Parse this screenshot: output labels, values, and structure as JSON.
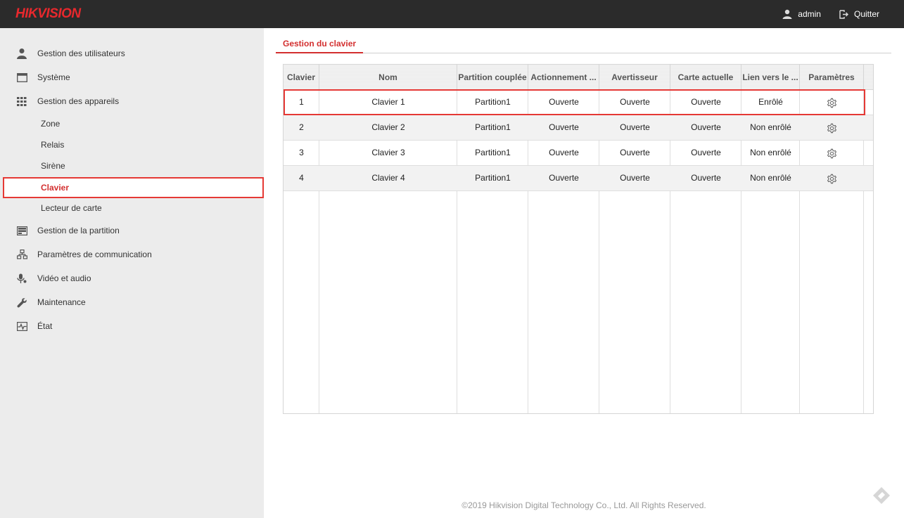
{
  "header": {
    "brand": "HIKVISION",
    "user": "admin",
    "logout": "Quitter"
  },
  "sidebar": {
    "items": [
      {
        "label": "Gestion des utilisateurs",
        "icon": "user-icon"
      },
      {
        "label": "Système",
        "icon": "window-icon"
      },
      {
        "label": "Gestion des appareils",
        "icon": "grid-icon"
      },
      {
        "label": "Gestion de la partition",
        "icon": "partition-icon"
      },
      {
        "label": "Paramètres de communication",
        "icon": "network-icon"
      },
      {
        "label": "Vidéo et audio",
        "icon": "microphone-icon"
      },
      {
        "label": "Maintenance",
        "icon": "wrench-icon"
      },
      {
        "label": "État",
        "icon": "pulse-icon"
      }
    ],
    "sub_items": [
      {
        "label": "Zone"
      },
      {
        "label": "Relais"
      },
      {
        "label": "Sirène"
      },
      {
        "label": "Clavier",
        "active": true
      },
      {
        "label": "Lecteur de carte"
      }
    ]
  },
  "tab": {
    "label": "Gestion du clavier"
  },
  "table": {
    "columns": [
      "Clavier",
      "Nom",
      "Partition couplée",
      "Actionnement ...",
      "Avertisseur",
      "Carte actuelle",
      "Lien vers le ...",
      "Paramètres"
    ],
    "rows": [
      {
        "id": "1",
        "name": "Clavier 1",
        "partition": "Partition1",
        "actuation": "Ouverte",
        "warning": "Ouverte",
        "card": "Ouverte",
        "link": "Enrôlé"
      },
      {
        "id": "2",
        "name": "Clavier 2",
        "partition": "Partition1",
        "actuation": "Ouverte",
        "warning": "Ouverte",
        "card": "Ouverte",
        "link": "Non enrôlé"
      },
      {
        "id": "3",
        "name": "Clavier 3",
        "partition": "Partition1",
        "actuation": "Ouverte",
        "warning": "Ouverte",
        "card": "Ouverte",
        "link": "Non enrôlé"
      },
      {
        "id": "4",
        "name": "Clavier 4",
        "partition": "Partition1",
        "actuation": "Ouverte",
        "warning": "Ouverte",
        "card": "Ouverte",
        "link": "Non enrôlé"
      }
    ],
    "settings_icon": "gear-icon"
  },
  "footer": {
    "copyright": "©2019 Hikvision Digital Technology Co., Ltd. All Rights Reserved."
  },
  "colors": {
    "accent": "#d32f2f",
    "header_bg": "#2b2b2b",
    "sidebar_bg": "#ececec"
  }
}
